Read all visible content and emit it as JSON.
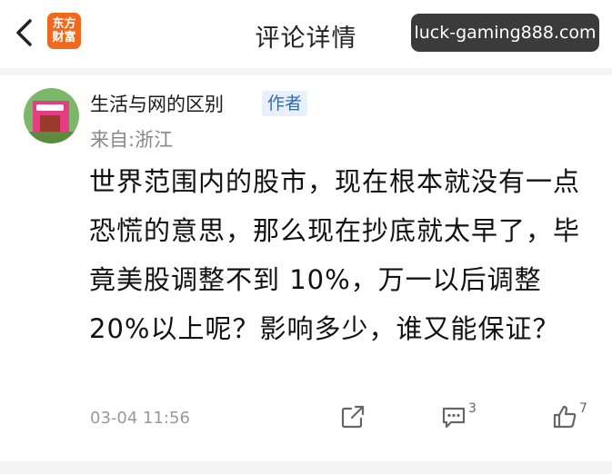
{
  "header": {
    "back_icon": "chevron-left-icon",
    "logo_line1": "东方",
    "logo_line2": "财富",
    "logo_color": "#f06a1e",
    "title": "评论详情",
    "watermark": "luck-gaming888.com"
  },
  "comment": {
    "avatar_icon": "avatar-image",
    "username": "生活与网的区别",
    "author_tag": "作者",
    "location": "来自:浙江",
    "body": "世界范围内的股市，现在根本就没有一点恐慌的意思，那么现在抄底就太早了，毕竟美股调整不到 10%，万一以后调整20%以上呢？影响多少，谁又能保证？",
    "timestamp": "03-04 11:56",
    "actions": {
      "share_icon": "share-icon",
      "comment_icon": "comment-icon",
      "comment_count": "3",
      "like_icon": "thumbs-up-icon",
      "like_count": "7"
    }
  },
  "colors": {
    "author_tag_bg": "#e8f1fb",
    "author_tag_text": "#2f6bb5",
    "meta_gray": "#999999"
  }
}
